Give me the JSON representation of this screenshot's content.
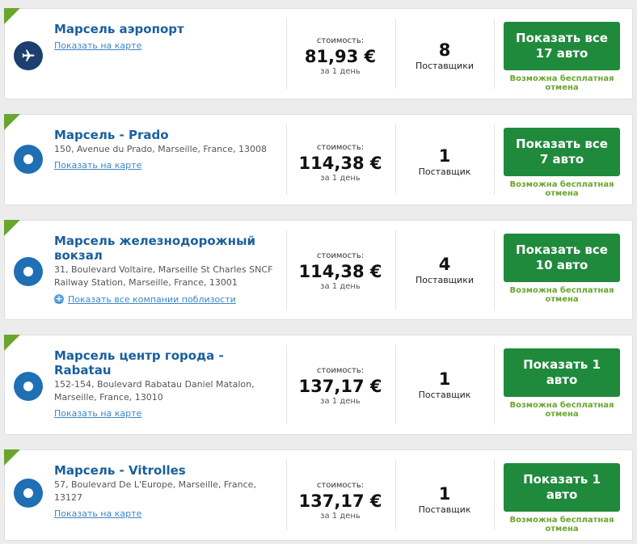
{
  "labels": {
    "price_label": "стоимость:",
    "per_day": "за 1 день",
    "free_cancel": "Возможна бесплатная отмена"
  },
  "colors": {
    "brand_blue": "#1a5f9e",
    "cta_green": "#1f8a3c",
    "corner_green": "#6aa52f"
  },
  "results": [
    {
      "name": "Марсель аэропорт",
      "address": "",
      "icon": "airplane-icon",
      "link": "Показать на карте",
      "price": "81,93 €",
      "suppliers_count": "8",
      "suppliers_label": "Поставщики",
      "button": "Показать все 17 авто"
    },
    {
      "name": "Марсель - Prado",
      "address": "150, Avenue du Prado, Marseille, France, 13008",
      "icon": "location-dot-icon",
      "link": "Показать на карте",
      "price": "114,38 €",
      "suppliers_count": "1",
      "suppliers_label": "Поставщик",
      "button": "Показать все 7 авто"
    },
    {
      "name": "Марсель железнодорожный вокзал",
      "address": "31, Boulevard Voltaire, Marseille St Charles SNCF Railway Station, Marseille, France, 13001",
      "icon": "location-dot-icon",
      "link": "Показать все компании поблизости",
      "price": "114,38 €",
      "suppliers_count": "4",
      "suppliers_label": "Поставщики",
      "button": "Показать все 10 авто"
    },
    {
      "name": "Марсель центр города - Rabatau",
      "address": "152-154, Boulevard Rabatau Daniel Matalon, Marseille, France, 13010",
      "icon": "location-dot-icon",
      "link": "Показать на карте",
      "price": "137,17 €",
      "suppliers_count": "1",
      "suppliers_label": "Поставщик",
      "button": "Показать 1 авто"
    },
    {
      "name": "Марсель - Vitrolles",
      "address": "57, Boulevard De L'Europe, Marseille, France, 13127",
      "icon": "location-dot-icon",
      "link": "Показать на карте",
      "price": "137,17 €",
      "suppliers_count": "1",
      "suppliers_label": "Поставщик",
      "button": "Показать 1 авто"
    }
  ]
}
